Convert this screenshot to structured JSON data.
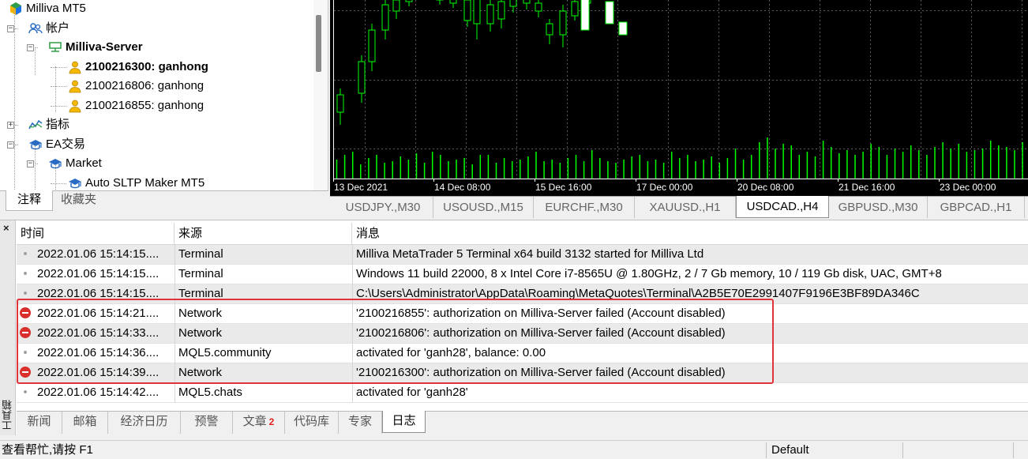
{
  "navigator": {
    "tree": [
      {
        "label": "Milliva MT5",
        "level": 0,
        "expander": "",
        "icon": "mt5-logo-icon",
        "bold": false
      },
      {
        "label": "帐户",
        "level": 1,
        "expander": "−",
        "icon": "accounts-icon",
        "bold": false
      },
      {
        "label": "Milliva-Server",
        "level": 2,
        "expander": "−",
        "icon": "server-icon",
        "bold": true
      },
      {
        "label": "2100216300: ganhong",
        "level": 3,
        "expander": "",
        "icon": "user-icon",
        "bold": true
      },
      {
        "label": "2100216806: ganhong",
        "level": 3,
        "expander": "",
        "icon": "user-icon",
        "bold": false
      },
      {
        "label": "2100216855: ganhong",
        "level": 3,
        "expander": "",
        "icon": "user-icon",
        "bold": false
      },
      {
        "label": "指标",
        "level": 1,
        "expander": "+",
        "icon": "indicators-icon",
        "bold": false
      },
      {
        "label": "EA交易",
        "level": 1,
        "expander": "−",
        "icon": "expert-icon",
        "bold": false
      },
      {
        "label": "Market",
        "level": 2,
        "expander": "−",
        "icon": "expert-icon",
        "bold": false
      },
      {
        "label": "Auto SLTP Maker MT5",
        "level": 3,
        "expander": "",
        "icon": "expert-icon",
        "bold": false
      }
    ],
    "tabs": [
      "注释",
      "收藏夹"
    ],
    "active_tab": 0
  },
  "chart": {
    "time_labels": [
      "13 Dec 2021",
      "14 Dec 08:00",
      "15 Dec 16:00",
      "17 Dec 00:00",
      "20 Dec 08:00",
      "21 Dec 16:00",
      "23 Dec 00:00"
    ],
    "colors": {
      "background": "#000000",
      "candle": "#00ff00",
      "grid": "#5a5a5a",
      "axis": "#ffffff"
    },
    "tabs": [
      "USDJPY.,M30",
      "USOUSD.,M15",
      "EURCHF.,M30",
      "XAUUSD.,H1",
      "USDCAD.,H4",
      "GBPUSD.,M30",
      "GBPCAD.,H1"
    ],
    "active_tab": 4
  },
  "toolbox": {
    "title": "工具箱",
    "close_glyph": "×",
    "columns": {
      "time": "时间",
      "source": "来源",
      "message": "消息"
    },
    "rows": [
      {
        "severity": "info",
        "time": "2022.01.06 15:14:15....",
        "source": "Terminal",
        "message": "Milliva MetaTrader 5 Terminal x64 build 3132 started for Milliva Ltd"
      },
      {
        "severity": "info",
        "time": "2022.01.06 15:14:15....",
        "source": "Terminal",
        "message": "Windows 11 build 22000, 8 x Intel Core i7-8565U  @ 1.80GHz, 2 / 7 Gb memory, 10 / 119 Gb disk, UAC, GMT+8"
      },
      {
        "severity": "info",
        "time": "2022.01.06 15:14:15....",
        "source": "Terminal",
        "message": "C:\\Users\\Administrator\\AppData\\Roaming\\MetaQuotes\\Terminal\\A2B5E70E2991407F9196E3BF89DA346C"
      },
      {
        "severity": "error",
        "time": "2022.01.06 15:14:21....",
        "source": "Network",
        "message": "'2100216855': authorization on Milliva-Server failed (Account disabled)"
      },
      {
        "severity": "error",
        "time": "2022.01.06 15:14:33....",
        "source": "Network",
        "message": "'2100216806': authorization on Milliva-Server failed (Account disabled)"
      },
      {
        "severity": "info",
        "time": "2022.01.06 15:14:36....",
        "source": "MQL5.community",
        "message": "activated for 'ganh28', balance: 0.00"
      },
      {
        "severity": "error",
        "time": "2022.01.06 15:14:39....",
        "source": "Network",
        "message": "'2100216300': authorization on Milliva-Server failed (Account disabled)"
      },
      {
        "severity": "info",
        "time": "2022.01.06 15:14:42....",
        "source": "MQL5.chats",
        "message": "activated for 'ganh28'"
      }
    ],
    "tabs": [
      {
        "label": "新闻",
        "badge": ""
      },
      {
        "label": "邮箱",
        "badge": ""
      },
      {
        "label": "经济日历",
        "badge": ""
      },
      {
        "label": "预警",
        "badge": ""
      },
      {
        "label": "文章",
        "badge": "2"
      },
      {
        "label": "代码库",
        "badge": ""
      },
      {
        "label": "专家",
        "badge": ""
      },
      {
        "label": "日志",
        "badge": ""
      }
    ],
    "active_tab": 7,
    "highlight_color": "#e0333a"
  },
  "status": {
    "help_text": "查看帮忙,请按 F1",
    "profile": "Default"
  }
}
